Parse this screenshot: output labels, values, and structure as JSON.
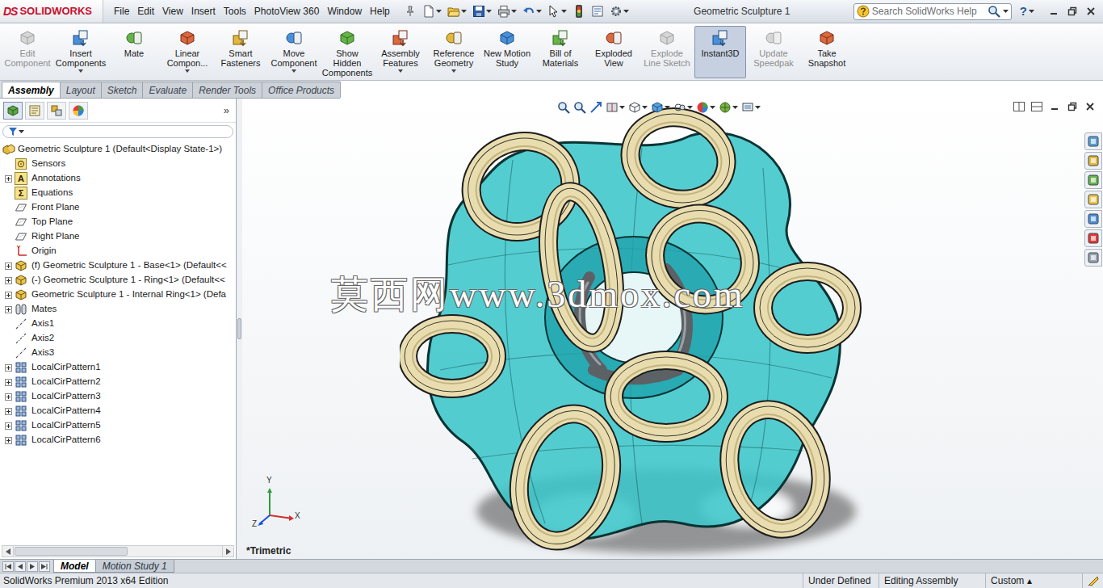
{
  "app": {
    "mark": "DS",
    "name": "SOLIDWORKS"
  },
  "menu": [
    "File",
    "Edit",
    "View",
    "Insert",
    "Tools",
    "PhotoView 360",
    "Window",
    "Help"
  ],
  "window": {
    "title": "Geometric Sculpture 1"
  },
  "search": {
    "placeholder": "Search SolidWorks Help"
  },
  "help": "?",
  "ribbon": [
    {
      "label": "Edit Component",
      "disabled": true,
      "selected": false,
      "dropdown": false
    },
    {
      "label": "Insert Components",
      "disabled": false,
      "selected": false,
      "dropdown": true
    },
    {
      "label": "Mate",
      "disabled": false,
      "selected": false,
      "dropdown": false
    },
    {
      "label": "Linear Compon...",
      "disabled": false,
      "selected": false,
      "dropdown": true
    },
    {
      "label": "Smart Fasteners",
      "disabled": false,
      "selected": false,
      "dropdown": false
    },
    {
      "label": "Move Component",
      "disabled": false,
      "selected": false,
      "dropdown": true
    },
    {
      "label": "Show Hidden Components",
      "disabled": false,
      "selected": false,
      "dropdown": false
    },
    {
      "label": "Assembly Features",
      "disabled": false,
      "selected": false,
      "dropdown": true
    },
    {
      "label": "Reference Geometry",
      "disabled": false,
      "selected": false,
      "dropdown": true
    },
    {
      "label": "New Motion Study",
      "disabled": false,
      "selected": false,
      "dropdown": false
    },
    {
      "label": "Bill of Materials",
      "disabled": false,
      "selected": false,
      "dropdown": false
    },
    {
      "label": "Exploded View",
      "disabled": false,
      "selected": false,
      "dropdown": false
    },
    {
      "label": "Explode Line Sketch",
      "disabled": true,
      "selected": false,
      "dropdown": false
    },
    {
      "label": "Instant3D",
      "disabled": false,
      "selected": true,
      "dropdown": false
    },
    {
      "label": "Update Speedpak",
      "disabled": true,
      "selected": false,
      "dropdown": false
    },
    {
      "label": "Take Snapshot",
      "disabled": false,
      "selected": false,
      "dropdown": false
    }
  ],
  "tabs": [
    {
      "label": "Assembly",
      "selected": true
    },
    {
      "label": "Layout",
      "selected": false
    },
    {
      "label": "Sketch",
      "selected": false
    },
    {
      "label": "Evaluate",
      "selected": false
    },
    {
      "label": "Render Tools",
      "selected": false
    },
    {
      "label": "Office Products",
      "selected": false
    }
  ],
  "feature_manager": {
    "expand": "»",
    "root": "Geometric Sculpture 1  (Default<Display State-1>)",
    "items": [
      {
        "label": "Sensors",
        "kind": "sensor",
        "expandable": false
      },
      {
        "label": "Annotations",
        "kind": "annotation",
        "expandable": true,
        "glyph": "A"
      },
      {
        "label": "Equations",
        "kind": "equation",
        "expandable": false,
        "glyph": "Σ"
      },
      {
        "label": "Front Plane",
        "kind": "plane",
        "expandable": false
      },
      {
        "label": "Top Plane",
        "kind": "plane",
        "expandable": false
      },
      {
        "label": "Right Plane",
        "kind": "plane",
        "expandable": false
      },
      {
        "label": "Origin",
        "kind": "origin",
        "expandable": false
      },
      {
        "label": "(f) Geometric Sculpture 1 - Base<1> (Default<<",
        "kind": "part",
        "expandable": true
      },
      {
        "label": "(-) Geometric Sculpture 1 - Ring<1> (Default<<",
        "kind": "part",
        "expandable": true
      },
      {
        "label": "Geometric Sculpture 1 - Internal Ring<1> (Defa",
        "kind": "part",
        "expandable": true
      },
      {
        "label": "Mates",
        "kind": "mates",
        "expandable": true
      },
      {
        "label": "Axis1",
        "kind": "axis",
        "expandable": false
      },
      {
        "label": "Axis2",
        "kind": "axis",
        "expandable": false
      },
      {
        "label": "Axis3",
        "kind": "axis",
        "expandable": false
      },
      {
        "label": "LocalCirPattern1",
        "kind": "pattern",
        "expandable": true
      },
      {
        "label": "LocalCirPattern2",
        "kind": "pattern",
        "expandable": true
      },
      {
        "label": "LocalCirPattern3",
        "kind": "pattern",
        "expandable": true
      },
      {
        "label": "LocalCirPattern4",
        "kind": "pattern",
        "expandable": true
      },
      {
        "label": "LocalCirPattern5",
        "kind": "pattern",
        "expandable": true
      },
      {
        "label": "LocalCirPattern6",
        "kind": "pattern",
        "expandable": true
      }
    ]
  },
  "viewport": {
    "view": "*Trimetric",
    "watermark": "莫西网www.3dmox.com",
    "axes": [
      "Y",
      "X",
      "Z"
    ]
  },
  "bottom_tabs": [
    {
      "label": "Model",
      "selected": true
    },
    {
      "label": "Motion Study 1",
      "selected": false
    }
  ],
  "status_bar": {
    "edition": "SolidWorks Premium 2013 x64 Edition",
    "items": [
      "Under Defined",
      "Editing Assembly",
      "Custom ▴"
    ]
  }
}
